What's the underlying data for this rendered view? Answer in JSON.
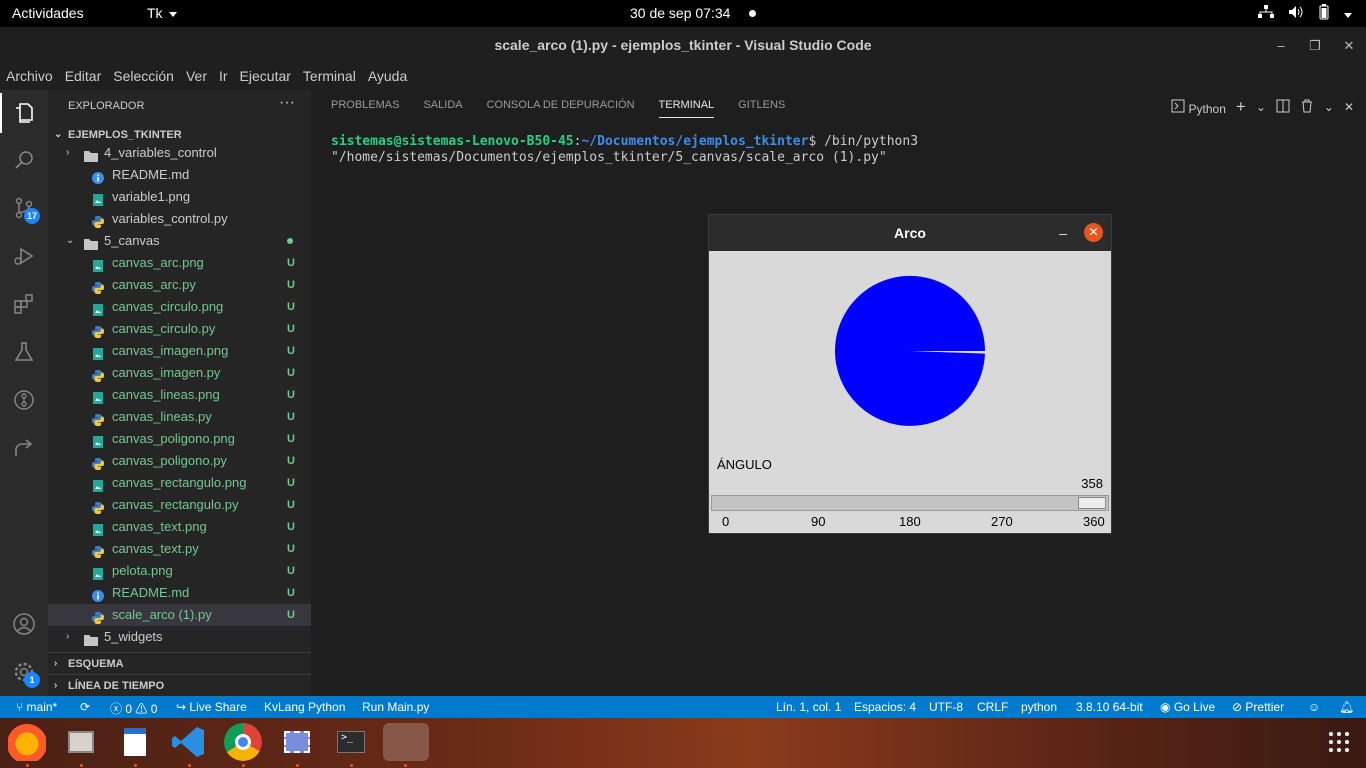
{
  "topbar": {
    "activities": "Actividades",
    "app": "Tk",
    "clock": "30 de sep  07:34"
  },
  "window": {
    "title": "scale_arco (1).py - ejemplos_tkinter - Visual Studio Code"
  },
  "menu": [
    "Archivo",
    "Editar",
    "Selección",
    "Ver",
    "Ir",
    "Ejecutar",
    "Terminal",
    "Ayuda"
  ],
  "activity": {
    "scm_badge": "17",
    "settings_badge": "1"
  },
  "explorer": {
    "header": "EXPLORADOR",
    "root": "EJEMPLOS_TKINTER",
    "rows": [
      {
        "label": "4_variables_control",
        "kind": "folder",
        "status": ""
      },
      {
        "label": "README.md",
        "kind": "info",
        "status": ""
      },
      {
        "label": "variable1.png",
        "kind": "image",
        "status": ""
      },
      {
        "label": "variables_control.py",
        "kind": "python",
        "status": ""
      },
      {
        "label": "5_canvas",
        "kind": "folder-open",
        "status": "dot"
      },
      {
        "label": "canvas_arc.png",
        "kind": "image",
        "status": "U"
      },
      {
        "label": "canvas_arc.py",
        "kind": "python",
        "status": "U"
      },
      {
        "label": "canvas_circulo.png",
        "kind": "image",
        "status": "U"
      },
      {
        "label": "canvas_circulo.py",
        "kind": "python",
        "status": "U"
      },
      {
        "label": "canvas_imagen.png",
        "kind": "image",
        "status": "U"
      },
      {
        "label": "canvas_imagen.py",
        "kind": "python",
        "status": "U"
      },
      {
        "label": "canvas_lineas.png",
        "kind": "image",
        "status": "U"
      },
      {
        "label": "canvas_lineas.py",
        "kind": "python",
        "status": "U"
      },
      {
        "label": "canvas_poligono.png",
        "kind": "image",
        "status": "U"
      },
      {
        "label": "canvas_poligono.py",
        "kind": "python",
        "status": "U"
      },
      {
        "label": "canvas_rectangulo.png",
        "kind": "image",
        "status": "U"
      },
      {
        "label": "canvas_rectangulo.py",
        "kind": "python",
        "status": "U"
      },
      {
        "label": "canvas_text.png",
        "kind": "image",
        "status": "U"
      },
      {
        "label": "canvas_text.py",
        "kind": "python",
        "status": "U"
      },
      {
        "label": "pelota.png",
        "kind": "image",
        "status": "U"
      },
      {
        "label": "README.md",
        "kind": "info",
        "status": "U"
      },
      {
        "label": "scale_arco (1).py",
        "kind": "python",
        "status": "U"
      },
      {
        "label": "5_widgets",
        "kind": "folder",
        "status": ""
      }
    ],
    "outline": "ESQUEMA",
    "timeline": "LÍNEA DE TIEMPO"
  },
  "panel": {
    "tabs": [
      "PROBLEMAS",
      "SALIDA",
      "CONSOLA DE DEPURACIÓN",
      "TERMINAL",
      "GITLENS"
    ],
    "active_tab": "TERMINAL",
    "shell": "Python",
    "terminal": {
      "user": "sistemas@sistemas-Lenovo-B50-45",
      "path": "~/Documentos/ejemplos_tkinter",
      "command": "$ /bin/python3 \"/home/sistemas/Documentos/ejemplos_tkinter/5_canvas/scale_arco (1).py\""
    }
  },
  "tk": {
    "title": "Arco",
    "angle_label": "ÁNGULO",
    "value": 358,
    "value_text": "358",
    "scale_max": 360,
    "ticks": [
      "0",
      "90",
      "180",
      "270",
      "360"
    ],
    "arc_color": "#0000ff"
  },
  "status": {
    "branch": "main*",
    "errors": "0",
    "warnings": "0",
    "liveshare": "Live Share",
    "kvlang": "KvLang Python",
    "runmain": "Run Main.py",
    "position": "Lín. 1, col. 1",
    "spaces": "Espacios: 4",
    "encoding": "UTF-8",
    "eol": "CRLF",
    "language": "python",
    "interpreter": "3.8.10 64-bit",
    "golive": "Go Live",
    "prettier": "Prettier"
  }
}
